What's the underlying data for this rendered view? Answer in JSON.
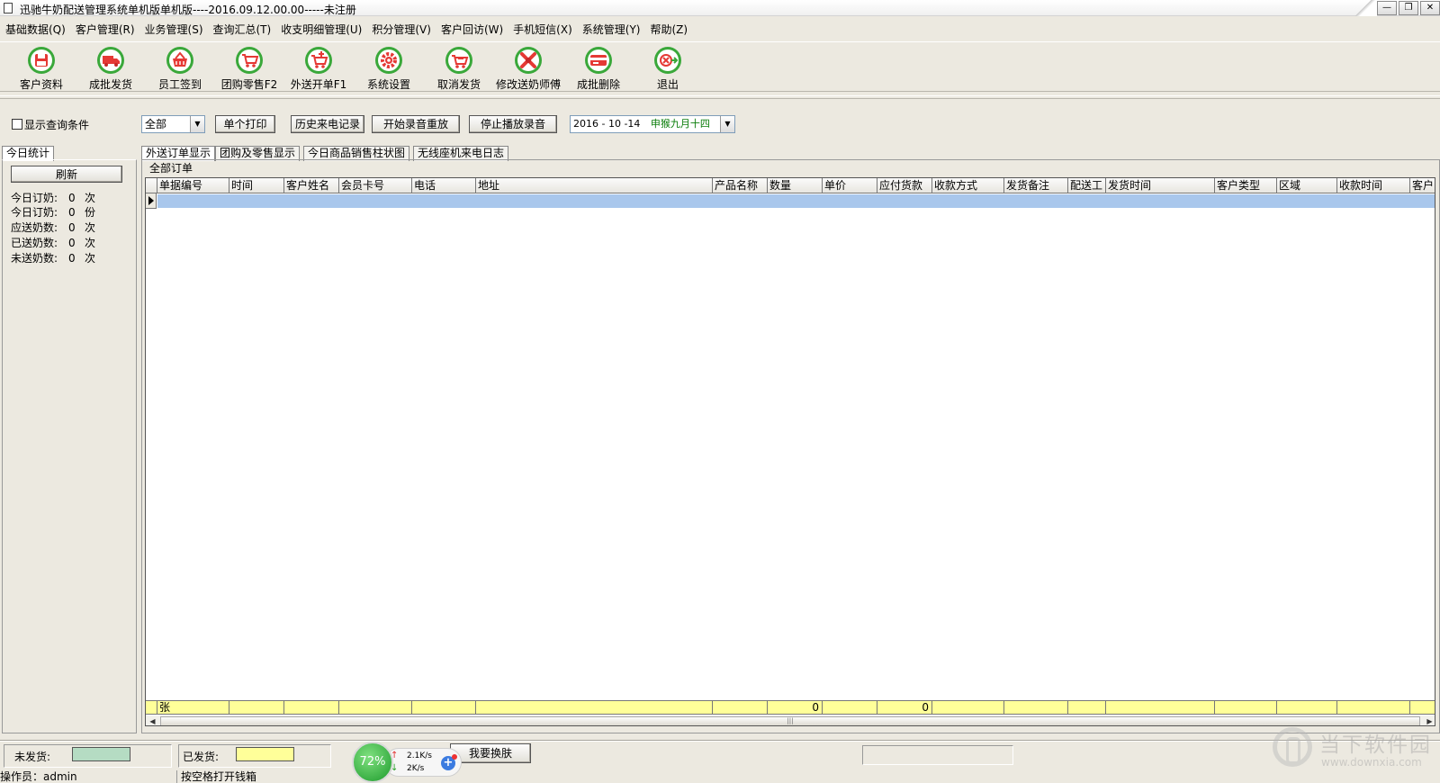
{
  "window": {
    "title": "迅驰牛奶配送管理系统单机版单机版----2016.09.12.00.00-----未注册",
    "controls": [
      "minimize",
      "restore",
      "close"
    ]
  },
  "menu": [
    "基础数据(Q)",
    "客户管理(R)",
    "业务管理(S)",
    "查询汇总(T)",
    "收支明细管理(U)",
    "积分管理(V)",
    "客户回访(W)",
    "手机短信(X)",
    "系统管理(Y)",
    "帮助(Z)"
  ],
  "toolbar": [
    {
      "label": "客户资料",
      "icon": "save-disk-icon"
    },
    {
      "label": "成批发货",
      "icon": "delivery-truck-icon"
    },
    {
      "label": "员工签到",
      "icon": "basket-icon"
    },
    {
      "label": "团购零售F2",
      "icon": "cart-icon"
    },
    {
      "label": "外送开单F1",
      "icon": "cart-plus-icon"
    },
    {
      "label": "系统设置",
      "icon": "gear-icon"
    },
    {
      "label": "取消发货",
      "icon": "cart-cancel-icon"
    },
    {
      "label": "修改送奶师傅",
      "icon": "tools-icon"
    },
    {
      "label": "成批删除",
      "icon": "card-delete-icon"
    },
    {
      "label": "退出",
      "icon": "exit-icon"
    }
  ],
  "query": {
    "show_conditions_label": "显示查询条件",
    "filter_value": "全部",
    "buttons": {
      "print": "单个打印",
      "history": "历史来电记录",
      "start_recording": "开始录音重放",
      "stop_recording": "停止播放录音"
    },
    "date": "2016 - 10 -14",
    "lunar": "申猴九月十四"
  },
  "left": {
    "tab": "今日统计",
    "refresh": "刷新",
    "stats": [
      {
        "label": "今日订奶:",
        "value": "0",
        "unit": "次"
      },
      {
        "label": "今日订奶:",
        "value": "0",
        "unit": "份"
      },
      {
        "label": "应送奶数:",
        "value": "0",
        "unit": "次"
      },
      {
        "label": "已送奶数:",
        "value": "0",
        "unit": "次"
      },
      {
        "label": "未送奶数:",
        "value": "0",
        "unit": "次"
      }
    ]
  },
  "main": {
    "tabs": [
      "外送订单显示",
      "团购及零售显示",
      "今日商品销售柱状图",
      "无线座机来电日志"
    ],
    "group_title": "全部订单",
    "columns": [
      "单据编号",
      "时间",
      "客户姓名",
      "会员卡号",
      "电话",
      "地址",
      "产品名称",
      "数量",
      "单价",
      "应付货款",
      "收款方式",
      "发货备注",
      "配送工",
      "发货时间",
      "客户类型",
      "区域",
      "收款时间",
      "客户"
    ],
    "footer": {
      "count_unit": "张",
      "quantity_total": "0",
      "amount_total": "0"
    }
  },
  "status": {
    "undelivered_label": "未发货:",
    "undelivered_color": "#b5dcc3",
    "delivered_label": "已发货:",
    "delivered_color": "#ffff99",
    "skin_button": "我要换肤",
    "operator": "操作员：admin",
    "hint": "按空格打开钱箱"
  },
  "speed_widget": {
    "percent": "72%",
    "up": "2.1K/s",
    "down": "2K/s"
  },
  "watermark": {
    "text": "当下软件园",
    "url": "www.downxia.com"
  }
}
